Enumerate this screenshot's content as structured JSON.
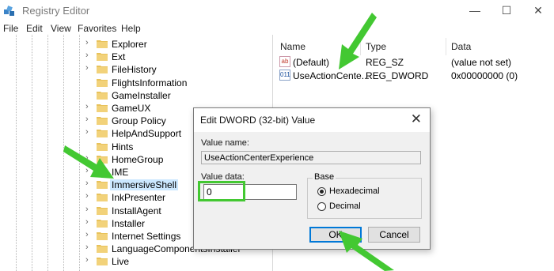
{
  "window": {
    "title": "Registry Editor"
  },
  "menu": [
    "File",
    "Edit",
    "View",
    "Favorites",
    "Help"
  ],
  "tree": {
    "items": [
      {
        "label": "Explorer",
        "expandable": true
      },
      {
        "label": "Ext",
        "expandable": true
      },
      {
        "label": "FileHistory",
        "expandable": true
      },
      {
        "label": "FlightsInformation",
        "expandable": false
      },
      {
        "label": "GameInstaller",
        "expandable": false
      },
      {
        "label": "GameUX",
        "expandable": true
      },
      {
        "label": "Group Policy",
        "expandable": true
      },
      {
        "label": "HelpAndSupport",
        "expandable": true
      },
      {
        "label": "Hints",
        "expandable": false
      },
      {
        "label": "HomeGroup",
        "expandable": true
      },
      {
        "label": "IME",
        "expandable": true
      },
      {
        "label": "ImmersiveShell",
        "expandable": true,
        "selected": true
      },
      {
        "label": "InkPresenter",
        "expandable": true
      },
      {
        "label": "InstallAgent",
        "expandable": true
      },
      {
        "label": "Installer",
        "expandable": true
      },
      {
        "label": "Internet Settings",
        "expandable": true
      },
      {
        "label": "LanguageComponentsInstaller",
        "expandable": true
      },
      {
        "label": "Live",
        "expandable": true
      }
    ]
  },
  "values_pane": {
    "columns": [
      "Name",
      "Type",
      "Data"
    ],
    "rows": [
      {
        "icon": "string-value-icon",
        "name": "(Default)",
        "type": "REG_SZ",
        "data": "(value not set)"
      },
      {
        "icon": "dword-value-icon",
        "name": "UseActionCente...",
        "type": "REG_DWORD",
        "data": "0x00000000 (0)"
      }
    ]
  },
  "dialog": {
    "title": "Edit DWORD (32-bit) Value",
    "value_name_label": "Value name:",
    "value_name": "UseActionCenterExperience",
    "value_data_label": "Value data:",
    "value_data": "0",
    "base_label": "Base",
    "radio_hex": "Hexadecimal",
    "radio_dec": "Decimal",
    "ok": "OK",
    "cancel": "Cancel"
  },
  "colors": {
    "accent": "#0078d7",
    "highlight_green": "#43c832",
    "folder": "#e8c25a",
    "selection": "#cce8ff"
  }
}
